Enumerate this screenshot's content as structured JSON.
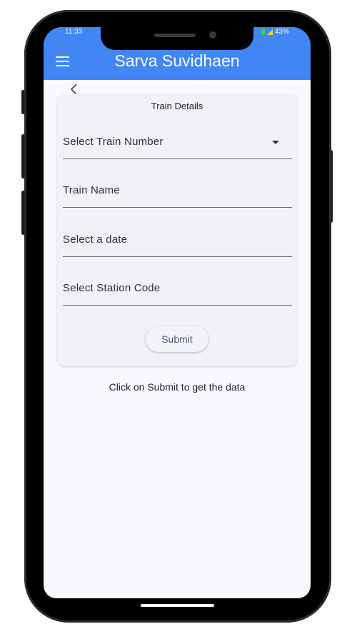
{
  "status_bar": {
    "time": "11:33",
    "battery": "43%"
  },
  "app_bar": {
    "title": "Sarva Suvidhaen",
    "menu_icon": "hamburger-menu-icon"
  },
  "back_icon": "chevron-left-icon",
  "card": {
    "title": "Train Details",
    "fields": [
      {
        "label": "Select Train Number",
        "type": "dropdown"
      },
      {
        "label": "Train Name",
        "type": "text"
      },
      {
        "label": "Select a date",
        "type": "date"
      },
      {
        "label": "Select Station Code",
        "type": "text"
      }
    ],
    "submit_label": "Submit"
  },
  "hint": "Click on Submit to get the data",
  "colors": {
    "app_bar": "#4285f4",
    "background": "#f8f8fd",
    "card": "#f1f2f7"
  }
}
